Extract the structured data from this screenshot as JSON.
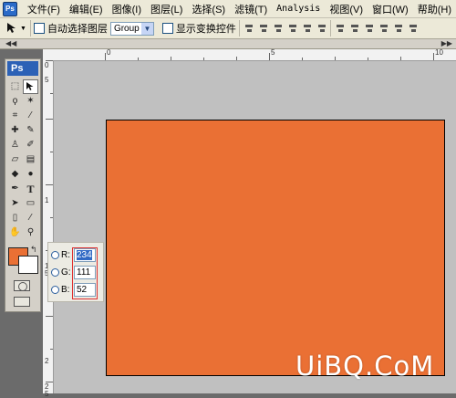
{
  "menubar": {
    "items": [
      "文件(F)",
      "编辑(E)",
      "图像(I)",
      "图层(L)",
      "选择(S)",
      "滤镜(T)",
      "Analysis",
      "视图(V)",
      "窗口(W)",
      "帮助(H)"
    ]
  },
  "options": {
    "tool_icon": "move-tool-icon",
    "auto_select_label": "自动选择图层",
    "auto_select_mode": "Group",
    "show_transform_label": "显示变换控件"
  },
  "toolbox": {
    "logo": "Ps",
    "foreground_color": "#ea7034",
    "background_color": "#ffffff"
  },
  "rulers": {
    "h_labels": [
      "0",
      "5",
      "10"
    ],
    "v_labels": [
      "0",
      "5",
      "1",
      "1 5",
      "2",
      "2 5"
    ]
  },
  "document": {
    "fill_color": "#ea7034",
    "backdrop_color": "#c0c0c0"
  },
  "color_readout": {
    "r_label": "R:",
    "g_label": "G:",
    "b_label": "B:",
    "r_value": "234",
    "g_value": "111",
    "b_value": "52"
  },
  "watermark": "UiBQ.CoM"
}
